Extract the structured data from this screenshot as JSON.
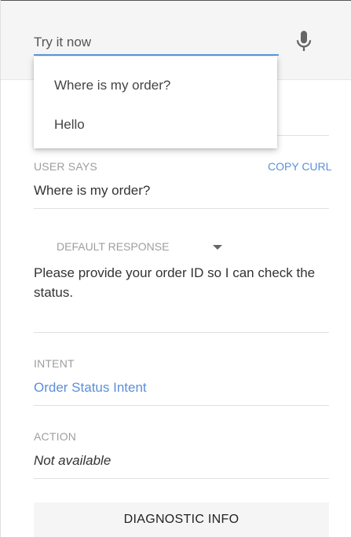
{
  "header": {
    "input_placeholder": "Try it now",
    "mic_icon": "microphone-icon"
  },
  "suggestions": [
    "Where is my order?",
    "Hello"
  ],
  "user_says": {
    "label": "USER SAYS",
    "copy_curl": "COPY CURL",
    "value": "Where is my order?"
  },
  "response": {
    "label": "DEFAULT RESPONSE",
    "text": "Please provide your order ID so I can check the status."
  },
  "intent": {
    "label": "INTENT",
    "value": "Order Status Intent"
  },
  "action": {
    "label": "ACTION",
    "value": "Not available"
  },
  "diagnostic_button": "DIAGNOSTIC INFO",
  "colors": {
    "accent": "#5b8fd9",
    "header_bg": "#f5f5f5"
  }
}
